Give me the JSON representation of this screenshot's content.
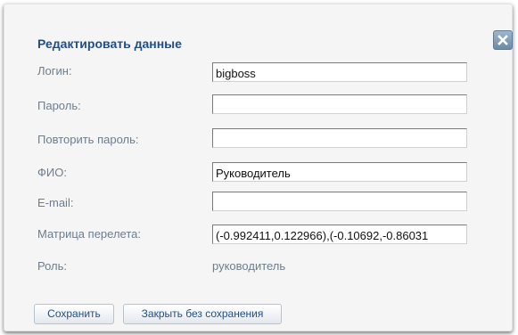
{
  "dialog": {
    "title": "Редактировать данные",
    "close_icon": "close-icon"
  },
  "fields": {
    "login": {
      "label": "Логин:",
      "value": "bigboss"
    },
    "password": {
      "label": "Пароль:",
      "value": ""
    },
    "password_repeat": {
      "label": "Повторить пароль:",
      "value": ""
    },
    "fio": {
      "label": "ФИО:",
      "value": "Руководитель"
    },
    "email": {
      "label": "E-mail:",
      "value": ""
    },
    "flight_matrix": {
      "label": "Матрица перелета:",
      "value": "(-0.992411,0.122966),(-0.10692,-0.86031"
    },
    "role": {
      "label": "Роль:",
      "value": "руководитель"
    }
  },
  "buttons": {
    "save": "Сохранить",
    "close_without_save": "Закрыть без сохранения"
  },
  "colors": {
    "title": "#1f4f89",
    "label": "#6d7d8d",
    "dialog_bg": "#f5f5f5",
    "close_button": "#7f9ab5"
  }
}
